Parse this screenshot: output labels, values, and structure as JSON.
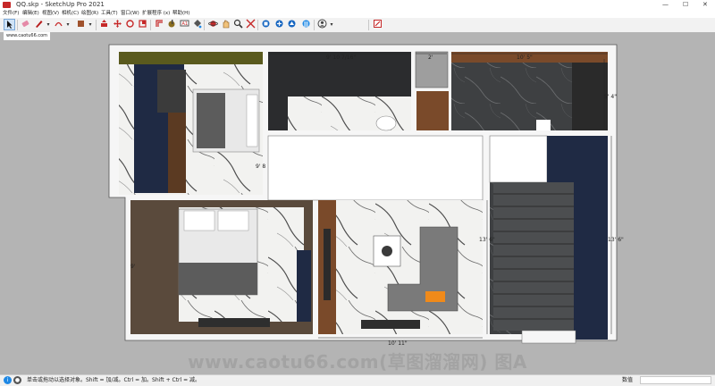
{
  "window": {
    "title": "QQ.skp - SketchUp Pro 2021",
    "controls": {
      "minimize": "—",
      "maximize": "☐",
      "close": "✕"
    }
  },
  "menu": {
    "items": [
      "文件(F)",
      "编辑(E)",
      "视图(V)",
      "相机(C)",
      "绘图(R)",
      "工具(T)",
      "窗口(W)",
      "扩展程序 (x)",
      "帮助(H)"
    ]
  },
  "toolbar": {
    "tools": [
      "select-tool",
      "eraser-tool",
      "line-tool",
      "arc-tool",
      "rectangle-tool",
      "push-pull-tool",
      "move-tool",
      "rotate-tool",
      "scale-tool",
      "tape-measure-tool",
      "text-tool",
      "paint-bucket-tool",
      "orbit-tool",
      "pan-tool",
      "zoom-tool",
      "zoom-extents-tool",
      "3d-warehouse-tool",
      "extension-warehouse-tool",
      "layout-tool",
      "account-tool",
      "send-to-layout-tool"
    ]
  },
  "viewport": {
    "site_tag": "www.caotu66.com",
    "dimensions": {
      "top_middle": "9' 10 7/16\"",
      "top_small": "2'",
      "top_right": "10' 5\"",
      "right_upper": "5' 4\"",
      "left_mid": "9' 8",
      "center_right": "13' 6\"",
      "far_right": "13' 6\"",
      "bottom": "10' 11\"",
      "bottom_left": "9'"
    }
  },
  "watermark": "www.caotu66.com(草图溜溜网) 图A",
  "statusbar": {
    "hint": "单击或拖动以选择对象。Shift = 加/减。Ctrl = 加。Shift + Ctrl = 减。",
    "measurements_label": "数值"
  },
  "colors": {
    "background": "#b4b4b4",
    "wall": "#f4f4f4",
    "olive_wall": "#5a5a1e",
    "navy_wall": "#1f2a44",
    "dark_floor": "#3d3f41",
    "wood": "#7a4a2a"
  }
}
